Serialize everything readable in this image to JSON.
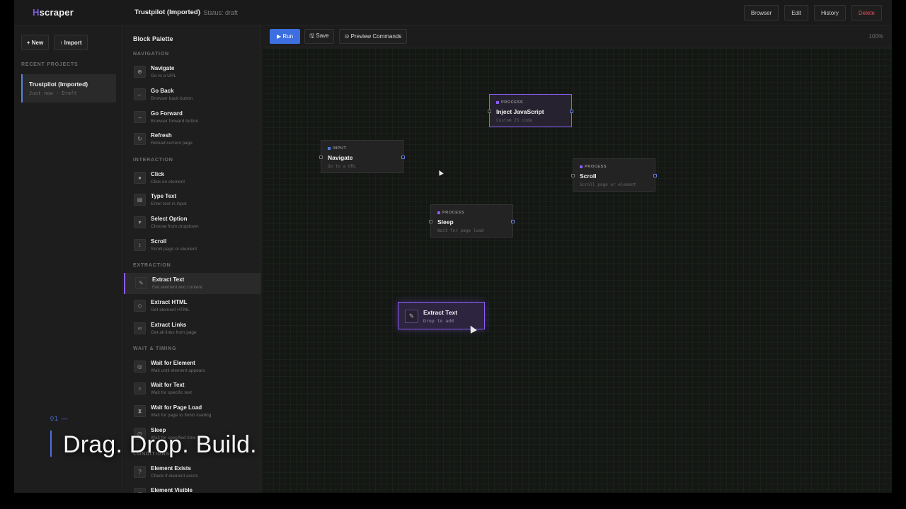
{
  "app": {
    "logo_mark": "H",
    "logo_text": "scraper",
    "project_title": "Trustpilot (Imported)",
    "project_status": "· Status: draft"
  },
  "top_actions": [
    "Browser",
    "Edit",
    "History",
    "Delete"
  ],
  "left_panel": {
    "new_label": "+ New",
    "import_label": "↑ Import",
    "recent_label": "RECENT PROJECTS",
    "recent_items": [
      {
        "name": "Trustpilot (Imported)",
        "sub": "Just now · Draft"
      }
    ]
  },
  "palette": {
    "title": "Block Palette",
    "sections": {
      "navigation": "NAVIGATION",
      "interaction": "INTERACTION",
      "extraction": "EXTRACTION",
      "wait": "WAIT & TIMING",
      "conditions": "CONDITIONS"
    },
    "blocks": [
      {
        "name": "Navigate",
        "desc": "Go to a URL",
        "icon": "globe-icon",
        "glyph": "⊕"
      },
      {
        "name": "Go Back",
        "desc": "Browser back button",
        "icon": "arrow-left-icon",
        "glyph": "←"
      },
      {
        "name": "Go Forward",
        "desc": "Browser forward button",
        "icon": "arrow-right-icon",
        "glyph": "→"
      },
      {
        "name": "Refresh",
        "desc": "Reload current page",
        "icon": "refresh-icon",
        "glyph": "↻"
      },
      {
        "name": "Click",
        "desc": "Click on element",
        "icon": "click-icon",
        "glyph": "●"
      },
      {
        "name": "Type Text",
        "desc": "Enter text in input",
        "icon": "keyboard-icon",
        "glyph": "▤"
      },
      {
        "name": "Select Option",
        "desc": "Choose from dropdown",
        "icon": "dropdown-icon",
        "glyph": "▾"
      },
      {
        "name": "Scroll",
        "desc": "Scroll page or element",
        "icon": "scroll-icon",
        "glyph": "↕"
      },
      {
        "name": "Extract Text",
        "desc": "Get element text content",
        "icon": "text-cursor-icon",
        "glyph": "✎"
      },
      {
        "name": "Extract HTML",
        "desc": "Get element HTML",
        "icon": "code-icon",
        "glyph": "◇"
      },
      {
        "name": "Extract Links",
        "desc": "Get all links from page",
        "icon": "link-icon",
        "glyph": "∞"
      },
      {
        "name": "Wait for Element",
        "desc": "Wait until element appears",
        "icon": "target-icon",
        "glyph": "◎"
      },
      {
        "name": "Wait for Text",
        "desc": "Wait for specific text",
        "icon": "search-icon",
        "glyph": "⌕"
      },
      {
        "name": "Wait for Page Load",
        "desc": "Wait for page to finish loading",
        "icon": "hourglass-icon",
        "glyph": "⧗"
      },
      {
        "name": "Sleep",
        "desc": "Wait for specified time",
        "icon": "clock-icon",
        "glyph": "◷"
      },
      {
        "name": "Element Exists",
        "desc": "Check if element exists",
        "icon": "question-icon",
        "glyph": "?"
      },
      {
        "name": "Element Visible",
        "desc": "",
        "icon": "eye-icon",
        "glyph": "◉"
      }
    ]
  },
  "toolbar": {
    "run_label": "▶ Run",
    "save_label": "🖫 Save",
    "preview_label": "⊙ Preview Commands",
    "zoom": "100%"
  },
  "canvas_nodes": [
    {
      "tag": "INPUT",
      "tag_color": "#4f7ce0",
      "title": "Navigate",
      "sub": "Go to a URL"
    },
    {
      "tag": "PROCESS",
      "tag_color": "#8b5cf6",
      "title": "Inject JavaScript",
      "sub": "Custom JS code"
    },
    {
      "tag": "PROCESS",
      "tag_color": "#8b5cf6",
      "title": "Scroll",
      "sub": "Scroll page or element"
    },
    {
      "tag": "PROCESS",
      "tag_color": "#8b5cf6",
      "title": "Sleep",
      "sub": "Wait for page load"
    }
  ],
  "drag_ghost": {
    "title": "Extract Text",
    "sub": "Drop to add",
    "icon": "text-cursor-icon",
    "glyph": "✎"
  },
  "caption": {
    "step": "01 —",
    "text": "Drag. Drop. Build."
  },
  "colors": {
    "accent": "#3d6fe0",
    "purple": "#8b5cf6",
    "danger": "#e0505a"
  }
}
